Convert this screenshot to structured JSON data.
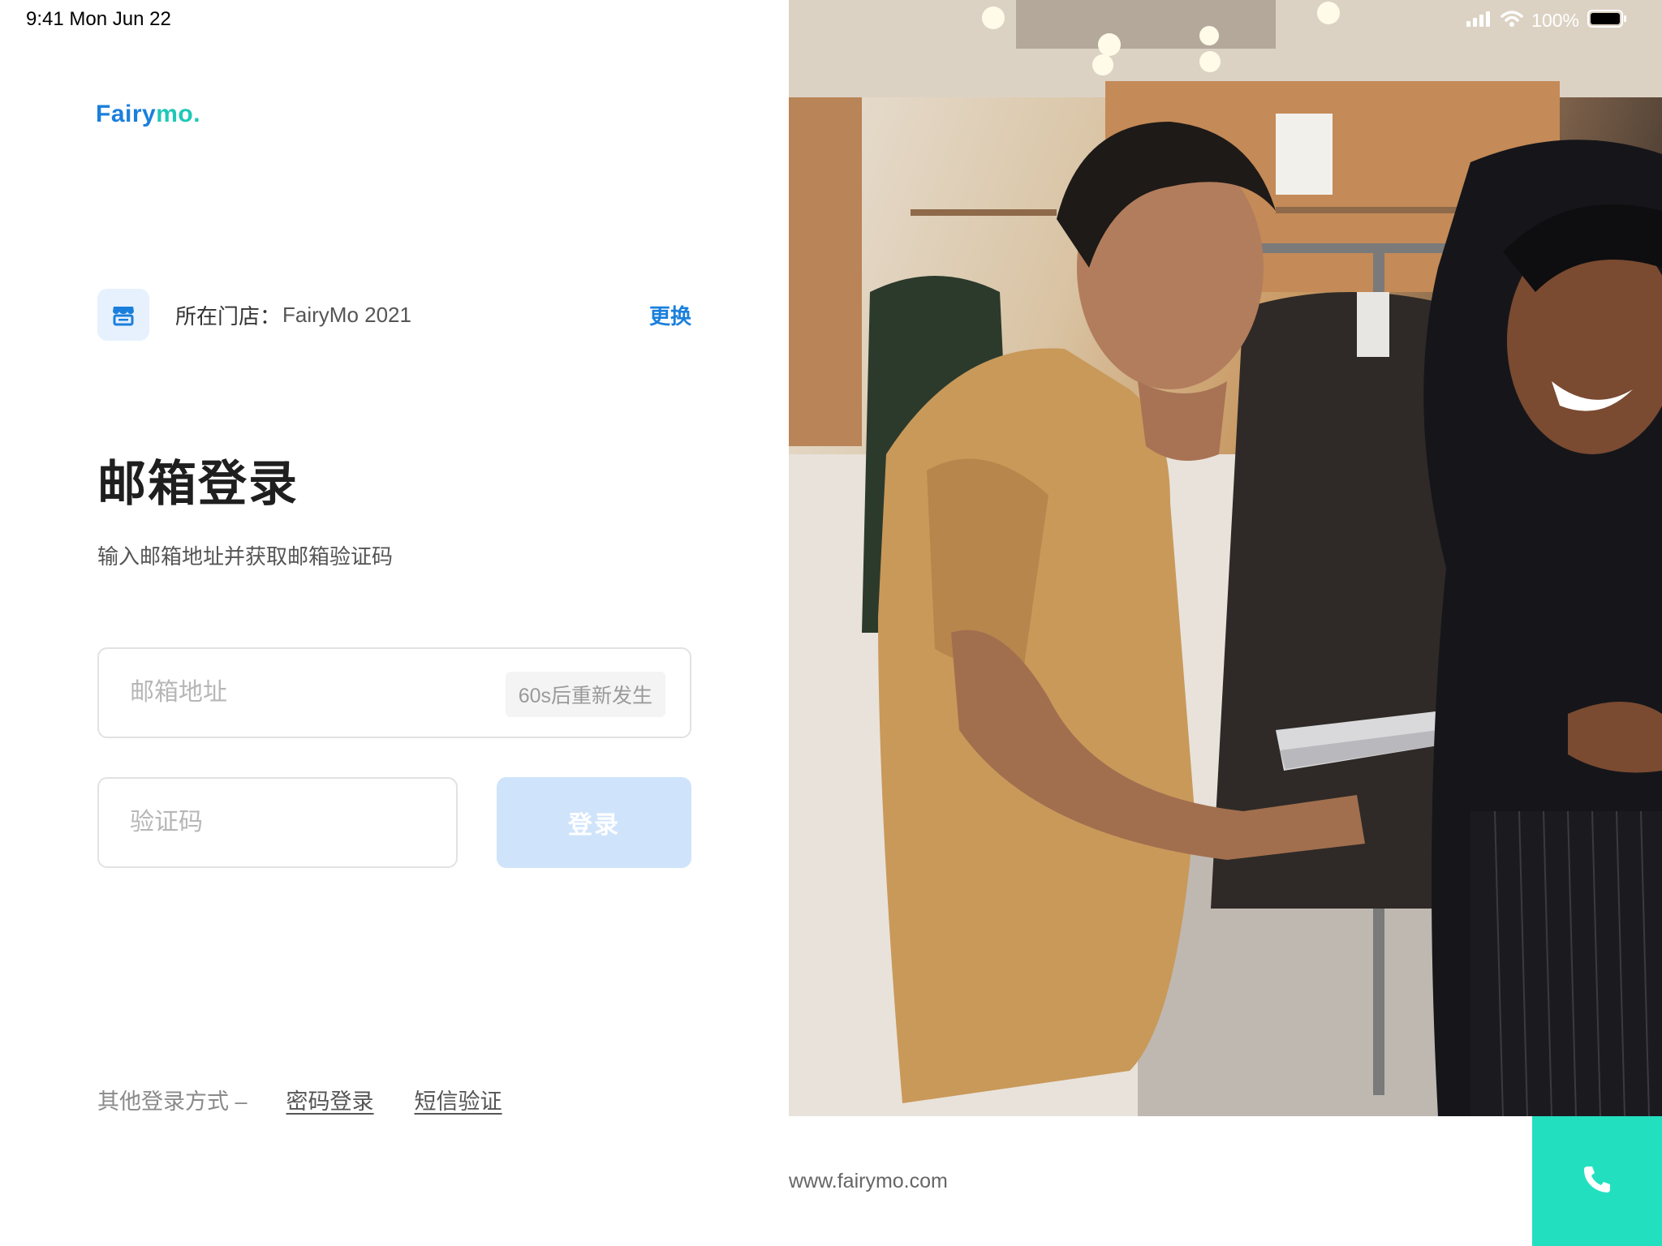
{
  "status_bar": {
    "time": "9:41 Mon Jun 22",
    "battery": "100%"
  },
  "brand": {
    "name_part1": "Fairy",
    "name_part2": "mo."
  },
  "store": {
    "label": "所在门店：",
    "name": "FairyMo 2021",
    "change_link": "更换"
  },
  "login": {
    "title": "邮箱登录",
    "subtitle": "输入邮箱地址并获取邮箱验证码",
    "email_placeholder": "邮箱地址",
    "resend_label": "60s后重新发生",
    "code_placeholder": "验证码",
    "submit_label": "登录"
  },
  "other_login": {
    "label": "其他登录方式 –",
    "password_link": "密码登录",
    "sms_link": "短信验证"
  },
  "footer": {
    "website": "www.fairymo.com"
  },
  "colors": {
    "brand_blue": "#1a7fdc",
    "brand_teal": "#1ec8b6",
    "call_button": "#22e0bf",
    "login_disabled": "#cfe4fb"
  },
  "icons": [
    "store-icon",
    "signal-icon",
    "wifi-icon",
    "battery-icon",
    "phone-icon"
  ]
}
